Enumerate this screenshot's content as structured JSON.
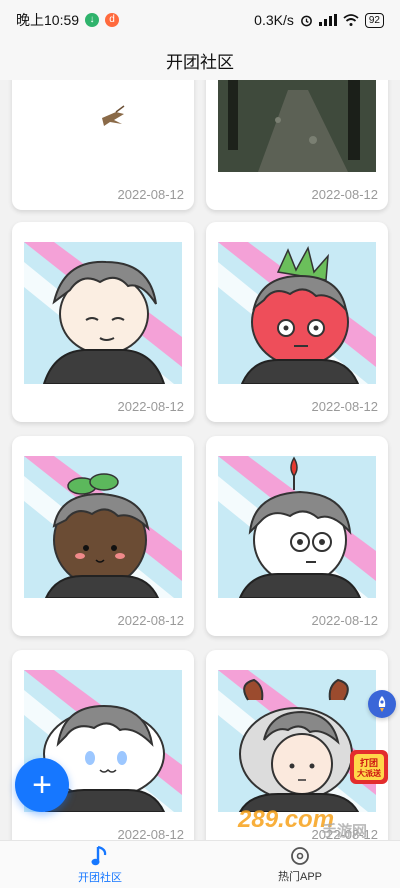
{
  "status_bar": {
    "time": "晚上10:59",
    "network_speed": "0.3K/s",
    "battery": "92"
  },
  "title": "开团社区",
  "posts": [
    {
      "date": "2022-08-12",
      "art": "sketch-bird"
    },
    {
      "date": "2022-08-12",
      "art": "dark-forest-path"
    },
    {
      "date": "2022-08-12",
      "art": "sleepy-boy"
    },
    {
      "date": "2022-08-12",
      "art": "dragonfruit-head"
    },
    {
      "date": "2022-08-12",
      "art": "potato-sprout-head"
    },
    {
      "date": "2022-08-12",
      "art": "white-cap-head"
    },
    {
      "date": "2022-08-12",
      "art": "white-puppy-hood"
    },
    {
      "date": "2022-08-12",
      "art": "ram-horn-hood"
    }
  ],
  "fab": {
    "label": "+"
  },
  "tabs": [
    {
      "label": "开团社区",
      "icon": "music-note-icon",
      "active": true
    },
    {
      "label": "热门APP",
      "icon": "disc-icon",
      "active": false
    }
  ],
  "promo": {
    "line1": "打团",
    "line2": "大派送"
  },
  "watermark": {
    "text": "289.com",
    "sub": "手游网"
  },
  "colors": {
    "accent": "#1677ff",
    "date_gray": "#9a9a9a"
  }
}
